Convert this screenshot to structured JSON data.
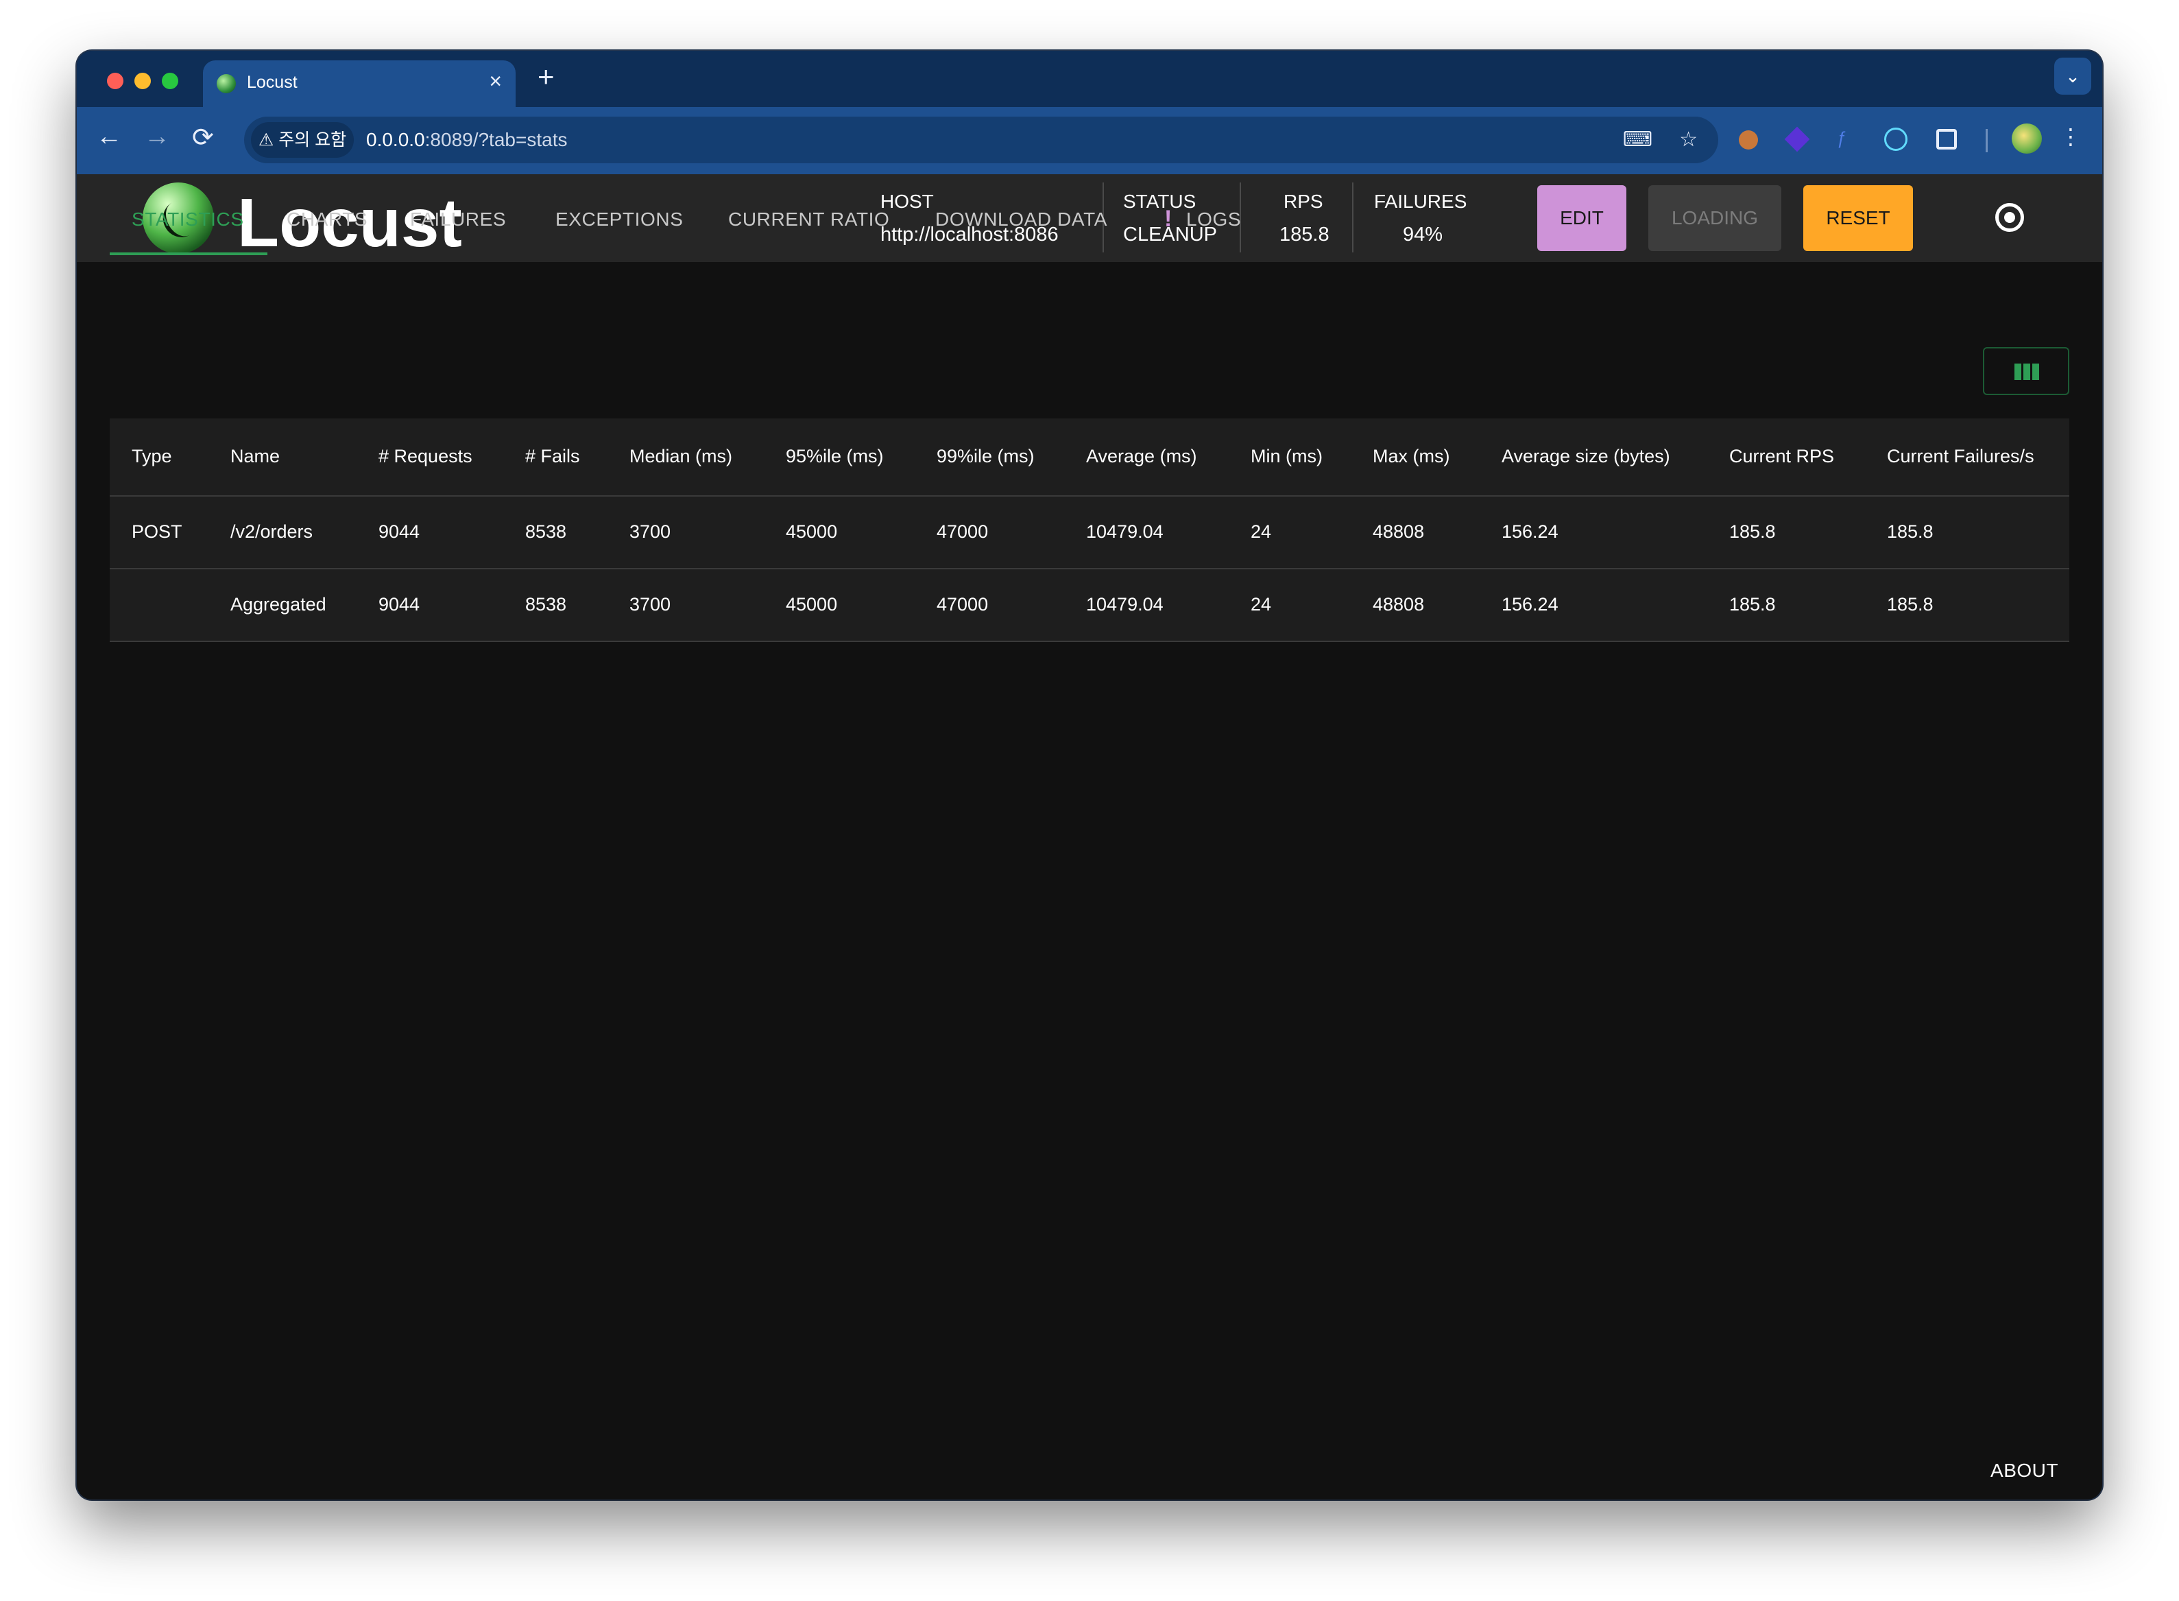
{
  "browser": {
    "tab_title": "Locust",
    "tab_close": "×",
    "new_tab": "+",
    "tab_dropdown": "⌄",
    "nav_back": "←",
    "nav_forward": "→",
    "nav_reload": "⟳",
    "security_chip": "⚠ 주의 요함",
    "url_host": "0.0.0.0",
    "url_rest": ":8089/?tab=stats",
    "translate_icon": "⌨",
    "bookmark_icon": "☆",
    "menu_icon": "⋮"
  },
  "app": {
    "brand": "Locust",
    "host_label": "HOST",
    "host_value": "http://localhost:8086",
    "status_label": "STATUS",
    "status_value": "CLEANUP",
    "rps_label": "RPS",
    "rps_value": "185.8",
    "failures_label": "FAILURES",
    "failures_value": "94%",
    "edit_label": "EDIT",
    "loading_label": "LOADING",
    "reset_label": "RESET"
  },
  "tabs": [
    {
      "label": "STATISTICS",
      "active": true
    },
    {
      "label": "CHARTS"
    },
    {
      "label": "FAILURES"
    },
    {
      "label": "EXCEPTIONS"
    },
    {
      "label": "CURRENT RATIO"
    },
    {
      "label": "DOWNLOAD DATA"
    },
    {
      "label": "LOGS",
      "alert": "!"
    }
  ],
  "table": {
    "columns": [
      "Type",
      "Name",
      "# Requests",
      "# Fails",
      "Median (ms)",
      "95%ile (ms)",
      "99%ile (ms)",
      "Average (ms)",
      "Min (ms)",
      "Max (ms)",
      "Average size (bytes)",
      "Current RPS",
      "Current Failures/s"
    ],
    "rows": [
      [
        "POST",
        "/v2/orders",
        "9044",
        "8538",
        "3700",
        "45000",
        "47000",
        "10479.04",
        "24",
        "48808",
        "156.24",
        "185.8",
        "185.8"
      ],
      [
        "",
        "Aggregated",
        "9044",
        "8538",
        "3700",
        "45000",
        "47000",
        "10479.04",
        "24",
        "48808",
        "156.24",
        "185.8",
        "185.8"
      ]
    ]
  },
  "footer": {
    "about": "ABOUT"
  },
  "colors": {
    "accent_green": "#2e9e55",
    "edit_button": "#ce93d8",
    "reset_button": "#ffa726",
    "browser_chrome": "#1e5090"
  }
}
